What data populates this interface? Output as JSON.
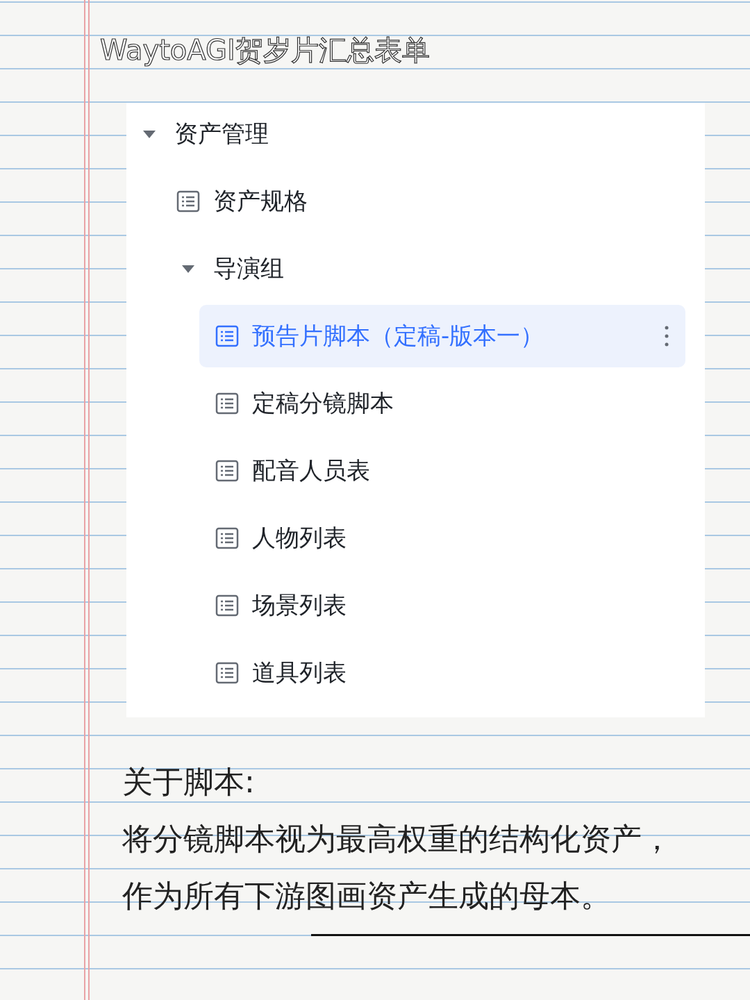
{
  "title": "WaytoAGI贺岁片汇总表单",
  "tree": [
    {
      "label": "资产管理",
      "kind": "folder",
      "expanded": true,
      "selected": false,
      "children": [
        {
          "label": "资产规格",
          "kind": "table",
          "selected": false
        },
        {
          "label": "导演组",
          "kind": "folder",
          "expanded": true,
          "selected": false,
          "children": [
            {
              "label": "预告片脚本（定稿-版本一）",
              "kind": "table",
              "selected": true
            },
            {
              "label": "定稿分镜脚本",
              "kind": "table",
              "selected": false
            },
            {
              "label": "配音人员表",
              "kind": "table",
              "selected": false
            },
            {
              "label": "人物列表",
              "kind": "table",
              "selected": false
            },
            {
              "label": "场景列表",
              "kind": "table",
              "selected": false
            },
            {
              "label": "道具列表",
              "kind": "table",
              "selected": false
            }
          ]
        }
      ]
    }
  ],
  "note": {
    "heading": "关于脚本:",
    "lines": [
      "将分镜脚本视为最高权重的结构化资产，",
      "作为所有下游图画资产生成的母本。"
    ]
  }
}
